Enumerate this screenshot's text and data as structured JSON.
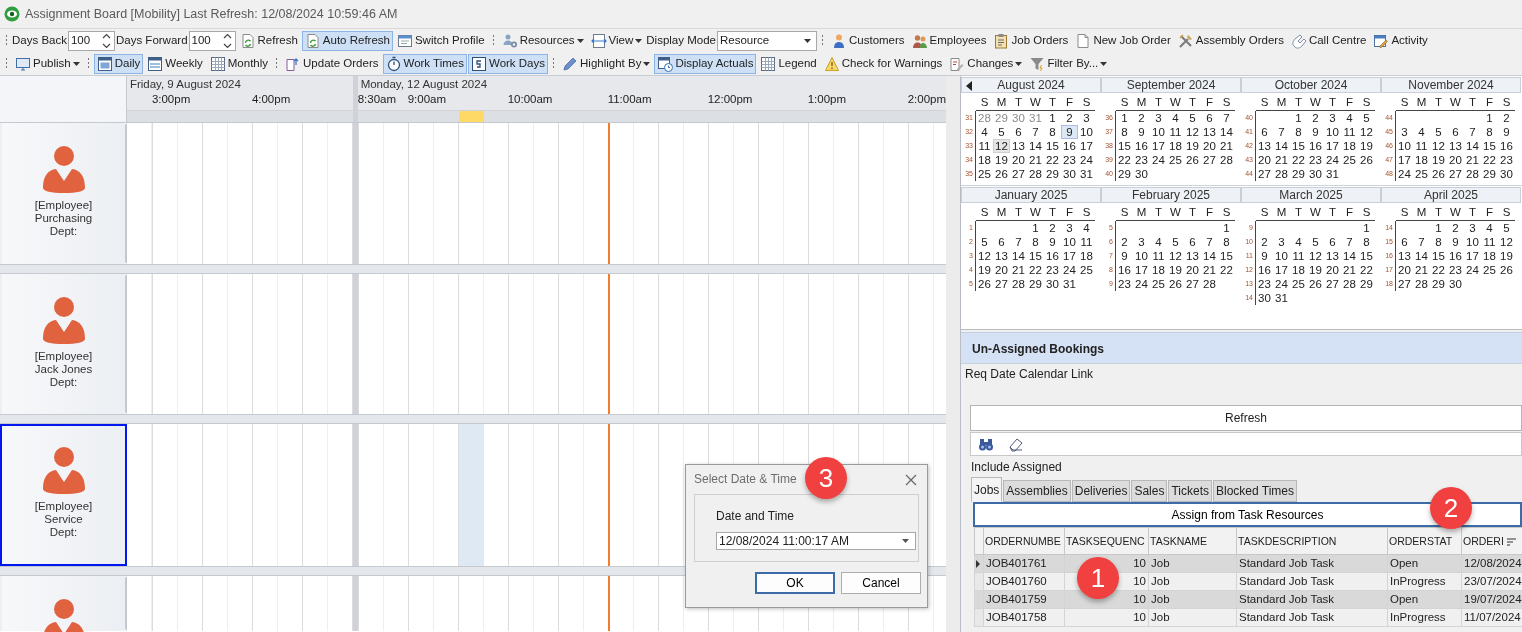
{
  "window": {
    "title": "Assignment Board [Mobility] Last Refresh: 12/08/2024 10:59:46 AM"
  },
  "toolbar_1": [
    {
      "kind": "grip"
    },
    {
      "kind": "label",
      "text": "Days Back"
    },
    {
      "kind": "spin",
      "value": "100"
    },
    {
      "kind": "label",
      "text": "Days Forward"
    },
    {
      "kind": "spin",
      "value": "100"
    },
    {
      "kind": "button",
      "label": "Refresh",
      "checked": false,
      "dropdown": false
    },
    {
      "kind": "button",
      "label": "Auto Refresh",
      "checked": true,
      "dropdown": false
    },
    {
      "kind": "button",
      "label": "Switch Profile",
      "checked": false,
      "dropdown": false
    },
    {
      "kind": "grip"
    },
    {
      "kind": "button",
      "label": "Resources",
      "checked": false,
      "dropdown": true
    },
    {
      "kind": "button",
      "label": "View",
      "checked": false,
      "dropdown": true
    },
    {
      "kind": "label",
      "text": "Display Mode"
    },
    {
      "kind": "combo",
      "value": "Resource"
    },
    {
      "kind": "grip"
    },
    {
      "kind": "button",
      "label": "Customers",
      "checked": false,
      "dropdown": false
    },
    {
      "kind": "button",
      "label": "Employees",
      "checked": false,
      "dropdown": false
    },
    {
      "kind": "button",
      "label": "Job Orders",
      "checked": false,
      "dropdown": false
    },
    {
      "kind": "button",
      "label": "New Job Order",
      "checked": false,
      "dropdown": false
    },
    {
      "kind": "button",
      "label": "Assembly Orders",
      "checked": false,
      "dropdown": false
    },
    {
      "kind": "button",
      "label": "Call Centre",
      "checked": false,
      "dropdown": false
    },
    {
      "kind": "button",
      "label": "Activity",
      "checked": false,
      "dropdown": false
    }
  ],
  "toolbar_2": [
    {
      "kind": "grip"
    },
    {
      "kind": "button",
      "label": "Publish",
      "checked": false,
      "dropdown": true
    },
    {
      "kind": "grip"
    },
    {
      "kind": "button",
      "label": "Daily",
      "checked": true,
      "dropdown": false
    },
    {
      "kind": "button",
      "label": "Weekly",
      "checked": false,
      "dropdown": false
    },
    {
      "kind": "button",
      "label": "Monthly",
      "checked": false,
      "dropdown": false
    },
    {
      "kind": "grip"
    },
    {
      "kind": "button",
      "label": "Update Orders",
      "checked": false,
      "dropdown": false
    },
    {
      "kind": "button",
      "label": "Work Times",
      "checked": true,
      "dropdown": false
    },
    {
      "kind": "button",
      "label": "Work Days",
      "checked": true,
      "dropdown": false
    },
    {
      "kind": "grip"
    },
    {
      "kind": "button",
      "label": "Highlight By",
      "checked": false,
      "dropdown": true
    },
    {
      "kind": "button",
      "label": "Display Actuals",
      "checked": true,
      "dropdown": false
    },
    {
      "kind": "button",
      "label": "Legend",
      "checked": false,
      "dropdown": false
    },
    {
      "kind": "button",
      "label": "Check for Warnings",
      "checked": false,
      "dropdown": false
    },
    {
      "kind": "button",
      "label": "Changes",
      "checked": false,
      "dropdown": true
    },
    {
      "kind": "button",
      "label": "Filter By...",
      "checked": false,
      "dropdown": true
    }
  ],
  "scheduler": {
    "days": [
      {
        "title": "Friday, 9 August 2024",
        "times": [
          "3:00pm",
          "4:00pm"
        ]
      },
      {
        "title": "Monday, 12 August 2024",
        "times": [
          "8:30am",
          "9:00am",
          "10:00am",
          "11:00am",
          "12:00pm",
          "1:00pm",
          "2:00pm"
        ]
      }
    ],
    "resources": [
      {
        "tag": "[Employee]",
        "name": "Purchasing",
        "dept": "Dept:",
        "selected": false,
        "highlighted_slot": false
      },
      {
        "tag": "[Employee]",
        "name": "Jack Jones",
        "dept": "Dept:",
        "selected": false,
        "highlighted_slot": false
      },
      {
        "tag": "[Employee]",
        "name": "Service",
        "dept": "Dept:",
        "selected": true,
        "highlighted_slot": true
      },
      {
        "selected": false,
        "highlighted_slot": false
      }
    ]
  },
  "calendar": {
    "month_rows": [
      [
        {
          "title": "August 2024",
          "weekdays": [
            "S",
            "M",
            "T",
            "W",
            "T",
            "F",
            "S"
          ],
          "weeks": [
            {
              "week": "31",
              "days": [
                {
                  "d": "28",
                  "muted": true
                },
                {
                  "d": "29",
                  "muted": true
                },
                {
                  "d": "30",
                  "muted": true
                },
                {
                  "d": "31",
                  "muted": true
                },
                "1",
                "2",
                "3"
              ]
            },
            {
              "week": "32",
              "days": [
                "4",
                "5",
                "6",
                "7",
                "8",
                {
                  "d": "9",
                  "selected": true
                },
                "10"
              ]
            },
            {
              "week": "33",
              "days": [
                "11",
                {
                  "d": "12",
                  "today": true
                },
                "13",
                "14",
                "15",
                "16",
                "17"
              ]
            },
            {
              "week": "34",
              "days": [
                "18",
                "19",
                "20",
                "21",
                "22",
                "23",
                "24"
              ]
            },
            {
              "week": "35",
              "days": [
                "25",
                "26",
                "27",
                "28",
                "29",
                "30",
                "31"
              ]
            }
          ]
        },
        {
          "title": "September 2024",
          "weekdays": [
            "S",
            "M",
            "T",
            "W",
            "T",
            "F",
            "S"
          ],
          "weeks": [
            {
              "week": "36",
              "days": [
                "1",
                "2",
                "3",
                "4",
                "5",
                "6",
                "7"
              ]
            },
            {
              "week": "37",
              "days": [
                "8",
                "9",
                "10",
                "11",
                "12",
                "13",
                "14"
              ]
            },
            {
              "week": "38",
              "days": [
                "15",
                "16",
                "17",
                "18",
                "19",
                "20",
                "21"
              ]
            },
            {
              "week": "39",
              "days": [
                "22",
                "23",
                "24",
                "25",
                "26",
                "27",
                "28"
              ]
            },
            {
              "week": "40",
              "days": [
                "29",
                "30"
              ]
            }
          ]
        },
        {
          "title": "October 2024",
          "weekdays": [
            "S",
            "M",
            "T",
            "W",
            "T",
            "F",
            "S"
          ],
          "weeks": [
            {
              "week": "40",
              "starts_late": true,
              "days": [
                "1",
                "2",
                "3",
                "4",
                "5"
              ]
            },
            {
              "week": "41",
              "days": [
                "6",
                "7",
                "8",
                "9",
                "10",
                "11",
                "12"
              ]
            },
            {
              "week": "42",
              "days": [
                "13",
                "14",
                "15",
                "16",
                "17",
                "18",
                "19"
              ]
            },
            {
              "week": "43",
              "days": [
                "20",
                "21",
                "22",
                "23",
                "24",
                "25",
                "26"
              ]
            },
            {
              "week": "44",
              "days": [
                "27",
                "28",
                "29",
                "30",
                "31"
              ]
            }
          ]
        },
        {
          "title": "November 2024",
          "weekdays": [
            "S",
            "M",
            "T",
            "W",
            "T",
            "F",
            "S"
          ],
          "weeks": [
            {
              "week": "44",
              "starts_late": true,
              "days": [
                "1",
                "2"
              ]
            },
            {
              "week": "45",
              "days": [
                "3",
                "4",
                "5",
                "6",
                "7",
                "8",
                "9"
              ]
            },
            {
              "week": "46",
              "days": [
                "10",
                "11",
                "12",
                "13",
                "14",
                "15",
                "16"
              ]
            },
            {
              "week": "47",
              "days": [
                "17",
                "18",
                "19",
                "20",
                "21",
                "22",
                "23"
              ]
            },
            {
              "week": "48",
              "days": [
                "24",
                "25",
                "26",
                "27",
                "28",
                "29",
                "30"
              ]
            }
          ]
        }
      ],
      [
        {
          "title": "January 2025",
          "weekdays": [
            "S",
            "M",
            "T",
            "W",
            "T",
            "F",
            "S"
          ],
          "weeks": [
            {
              "week": "1",
              "starts_late": true,
              "days": [
                "1",
                "2",
                "3",
                "4"
              ]
            },
            {
              "week": "2",
              "days": [
                "5",
                "6",
                "7",
                "8",
                "9",
                "10",
                "11"
              ]
            },
            {
              "week": "3",
              "days": [
                "12",
                "13",
                "14",
                "15",
                "16",
                "17",
                "18"
              ]
            },
            {
              "week": "4",
              "days": [
                "19",
                "20",
                "21",
                "22",
                "23",
                "24",
                "25"
              ]
            },
            {
              "week": "5",
              "days": [
                "26",
                "27",
                "28",
                "29",
                "30",
                "31"
              ]
            }
          ]
        },
        {
          "title": "February 2025",
          "weekdays": [
            "S",
            "M",
            "T",
            "W",
            "T",
            "F",
            "S"
          ],
          "weeks": [
            {
              "week": "5",
              "starts_late": true,
              "days": [
                "1"
              ]
            },
            {
              "week": "6",
              "days": [
                "2",
                "3",
                "4",
                "5",
                "6",
                "7",
                "8"
              ]
            },
            {
              "week": "7",
              "days": [
                "9",
                "10",
                "11",
                "12",
                "13",
                "14",
                "15"
              ]
            },
            {
              "week": "8",
              "days": [
                "16",
                "17",
                "18",
                "19",
                "20",
                "21",
                "22"
              ]
            },
            {
              "week": "9",
              "days": [
                "23",
                "24",
                "25",
                "26",
                "27",
                "28"
              ]
            }
          ]
        },
        {
          "title": "March 2025",
          "weekdays": [
            "S",
            "M",
            "T",
            "W",
            "T",
            "F",
            "S"
          ],
          "weeks": [
            {
              "week": "9",
              "starts_late": true,
              "days": [
                "1"
              ]
            },
            {
              "week": "10",
              "days": [
                "2",
                "3",
                "4",
                "5",
                "6",
                "7",
                "8"
              ]
            },
            {
              "week": "11",
              "days": [
                "9",
                "10",
                "11",
                "12",
                "13",
                "14",
                "15"
              ]
            },
            {
              "week": "12",
              "days": [
                "16",
                "17",
                "18",
                "19",
                "20",
                "21",
                "22"
              ]
            },
            {
              "week": "13",
              "days": [
                "23",
                "24",
                "25",
                "26",
                "27",
                "28",
                "29"
              ]
            },
            {
              "week": "14",
              "days": [
                "30",
                "31"
              ]
            }
          ]
        },
        {
          "title": "April 2025",
          "weekdays": [
            "S",
            "M",
            "T",
            "W",
            "T",
            "F",
            "S"
          ],
          "weeks": [
            {
              "week": "14",
              "starts_late": true,
              "days": [
                "1",
                "2",
                "3",
                "4",
                "5"
              ]
            },
            {
              "week": "15",
              "days": [
                "6",
                "7",
                "8",
                "9",
                "10",
                "11",
                "12"
              ]
            },
            {
              "week": "16",
              "days": [
                "13",
                "14",
                "15",
                "16",
                "17",
                "18",
                "19"
              ]
            },
            {
              "week": "17",
              "days": [
                "20",
                "21",
                "22",
                "23",
                "24",
                "25",
                "26"
              ]
            },
            {
              "week": "18",
              "days": [
                "27",
                "28",
                "29",
                "30"
              ]
            }
          ]
        }
      ]
    ]
  },
  "bookings": {
    "title": "Un-Assigned Bookings",
    "calendar_link": "Req Date Calendar Link",
    "refresh_button": "Refresh",
    "include_assigned": "Include Assigned",
    "tabs": [
      {
        "label": "Jobs",
        "selected": true
      },
      {
        "label": "Assemblies",
        "selected": false
      },
      {
        "label": "Deliveries",
        "selected": false
      },
      {
        "label": "Sales",
        "selected": false
      },
      {
        "label": "Tickets",
        "selected": false
      },
      {
        "label": "Blocked Times",
        "selected": false
      }
    ],
    "assign_button": "Assign from Task Resources",
    "table": {
      "columns": [
        {
          "label": "ORDERNUMBE",
          "sorted": false
        },
        {
          "label": "TASKSEQUENC",
          "sorted": false
        },
        {
          "label": "TASKNAME",
          "sorted": false
        },
        {
          "label": "TASKDESCRIPTION",
          "sorted": false
        },
        {
          "label": "ORDERSTAT",
          "sorted": false
        },
        {
          "label": "ORDERI",
          "sorted": true
        }
      ],
      "rows": [
        {
          "selected": true,
          "cells": [
            "JOB401761",
            "10",
            "Job",
            "Standard Job Task",
            "Open",
            "12/08/2024"
          ]
        },
        {
          "selected": false,
          "cells": [
            "JOB401760",
            "10",
            "Job",
            "Standard Job Task",
            "InProgress",
            "23/07/2024"
          ]
        },
        {
          "selected": false,
          "cells": [
            "JOB401759",
            "10",
            "Job",
            "Standard Job Task",
            "Open",
            "19/07/2024"
          ]
        },
        {
          "selected": false,
          "cells": [
            "JOB401758",
            "10",
            "Job",
            "Standard Job Task",
            "InProgress",
            "11/07/2024"
          ]
        }
      ]
    }
  },
  "dialog": {
    "title": "Select Date & Time",
    "field_label": "Date and Time",
    "value": "12/08/2024 11:00:17 AM",
    "buttons": [
      {
        "label": "OK",
        "default": true
      },
      {
        "label": "Cancel",
        "default": false
      }
    ]
  },
  "callouts": [
    {
      "label": "1"
    },
    {
      "label": "2"
    },
    {
      "label": "3"
    }
  ]
}
